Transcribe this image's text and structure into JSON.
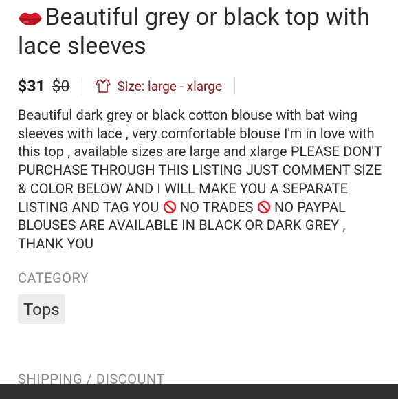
{
  "listing": {
    "title": "Beautiful grey or black  top with lace sleeves",
    "title_icon": "lips-icon",
    "price": "$31",
    "original_price": "$0",
    "size_label": "Size: large - xlarge",
    "size_icon": "shirt-icon",
    "description": {
      "part1": "Beautiful dark grey or black cotton blouse with bat wing sleeves with lace , very comfortable blouse I'm in love with this top ,  available sizes are large and xlarge PLEASE DON'T PURCHASE THROUGH THIS LISTING JUST COMMENT SIZE & COLOR BELOW AND I WILL MAKE YOU A SEPARATE LISTING AND TAG YOU ",
      "part2": " NO TRADES ",
      "part3": " NO PAYPAL BLOUSES ARE AVAILABLE IN BLACK OR DARK GREY , THANK YOU",
      "inline_icon": "no-entry-icon"
    },
    "category_label": "CATEGORY",
    "category_tag": "Tops",
    "shipping_label": "SHIPPING / DISCOUNT"
  },
  "colors": {
    "size_text": "#8e1d22",
    "tag_background": "#ececec",
    "bottom_bar": "#2f2f2f",
    "lips": "#d81b2a"
  }
}
